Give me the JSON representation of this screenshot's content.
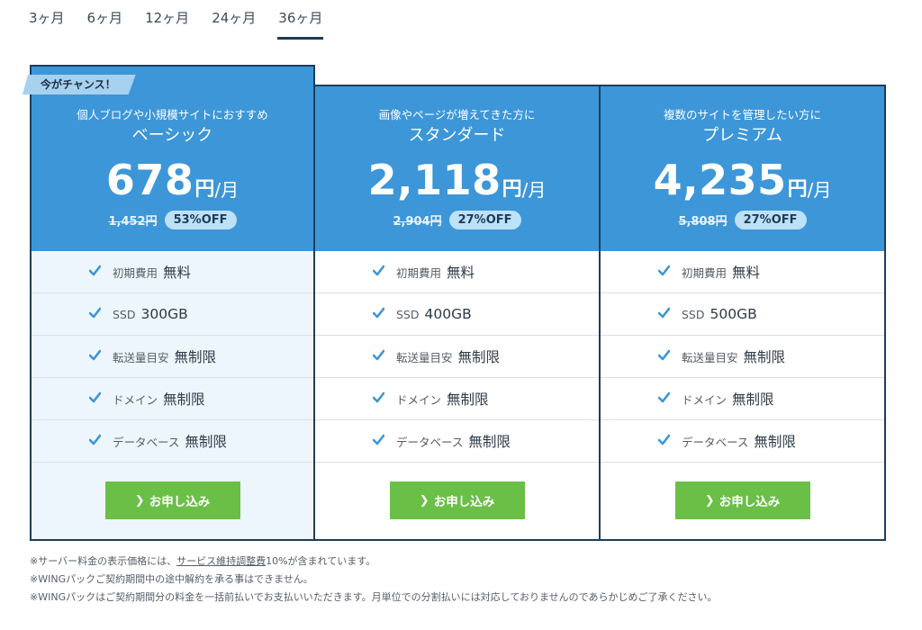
{
  "tabs": [
    {
      "label": "3ヶ月"
    },
    {
      "label": "6ヶ月"
    },
    {
      "label": "12ヶ月"
    },
    {
      "label": "24ヶ月"
    },
    {
      "label": "36ヶ月",
      "active": true
    }
  ],
  "plans": [
    {
      "badge": "今がチャンス！",
      "subtitle": "個人ブログや小規模サイトにおすすめ",
      "name": "ベーシック",
      "price": "678",
      "yen": "円",
      "per": "/月",
      "old_price": "1,452円",
      "discount": "53%OFF",
      "features": [
        {
          "label": "初期費用",
          "value": "無料"
        },
        {
          "label": "SSD",
          "value": "300GB"
        },
        {
          "label": "転送量目安",
          "value": "無制限"
        },
        {
          "label": "ドメイン",
          "value": "無制限"
        },
        {
          "label": "データベース",
          "value": "無制限"
        }
      ],
      "button": "お申し込み"
    },
    {
      "subtitle": "画像やページが増えてきた方に",
      "name": "スタンダード",
      "price": "2,118",
      "yen": "円",
      "per": "/月",
      "old_price": "2,904円",
      "discount": "27%OFF",
      "features": [
        {
          "label": "初期費用",
          "value": "無料"
        },
        {
          "label": "SSD",
          "value": "400GB"
        },
        {
          "label": "転送量目安",
          "value": "無制限"
        },
        {
          "label": "ドメイン",
          "value": "無制限"
        },
        {
          "label": "データベース",
          "value": "無制限"
        }
      ],
      "button": "お申し込み"
    },
    {
      "subtitle": "複数のサイトを管理したい方に",
      "name": "プレミアム",
      "price": "4,235",
      "yen": "円",
      "per": "/月",
      "old_price": "5,808円",
      "discount": "27%OFF",
      "features": [
        {
          "label": "初期費用",
          "value": "無料"
        },
        {
          "label": "SSD",
          "value": "500GB"
        },
        {
          "label": "転送量目安",
          "value": "無制限"
        },
        {
          "label": "ドメイン",
          "value": "無制限"
        },
        {
          "label": "データベース",
          "value": "無制限"
        }
      ],
      "button": "お申し込み"
    }
  ],
  "notes": {
    "line1_pre": "※サーバー料金の表示価格には、",
    "line1_link": "サービス維持調整費",
    "line1_post": "10%が含まれています。",
    "line2": "※WINGパックご契約期間中の途中解約を承る事はできません。",
    "line3": "※WINGパックはご契約期間分の料金を一括前払いでお支払いいただきます。月単位での分割払いには対応しておりませんのであらかじめご了承ください。"
  },
  "colors": {
    "header_blue": "#3c96d8",
    "border_navy": "#1d3d5c",
    "button_green": "#6abf47",
    "check_blue": "#3c96d8",
    "featured_bg": "#eef6fd"
  },
  "icons": {
    "check": "check-icon",
    "arrow": "chevron-right-icon"
  }
}
